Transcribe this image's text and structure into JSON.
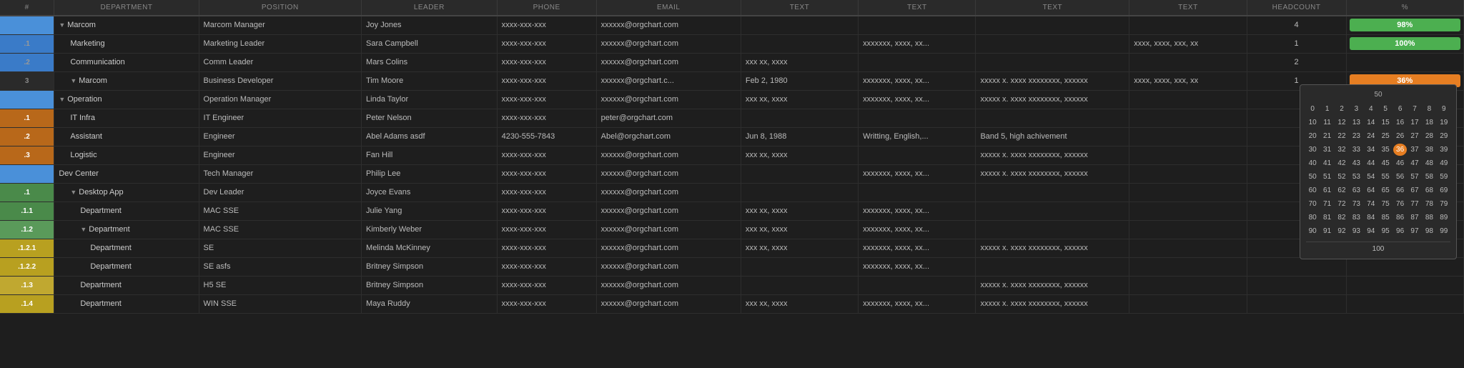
{
  "header": {
    "cols": [
      "#",
      "DEPARTMENT",
      "POSITION",
      "LEADER",
      "PHONE",
      "EMAIL",
      "TEXT",
      "TEXT",
      "TEXT",
      "TEXT",
      "HEADCOUNT",
      "%"
    ]
  },
  "rows": [
    {
      "id": "marcom-header",
      "hash": "",
      "hashClass": "hash-blue",
      "dept": "Marcom",
      "deptIndent": 0,
      "hasTriangle": true,
      "position": "Marcom Manager",
      "leader": "Joy Jones",
      "phone": "xxxx-xxx-xxx",
      "email": "xxxxxx@orgchart.com",
      "text1": "",
      "text2": "",
      "text3": "",
      "text4": "",
      "headcount": "4",
      "percent": "98%",
      "percentClass": "bar-green",
      "showPercent": true
    },
    {
      "id": "marketing",
      "hash": ".1",
      "hashClass": "hash-blue1",
      "dept": "Marketing",
      "deptIndent": 1,
      "hasTriangle": false,
      "position": "Marketing Leader",
      "leader": "Sara Campbell",
      "phone": "xxxx-xxx-xxx",
      "email": "xxxxxx@orgchart.com",
      "text1": "",
      "text2": "xxxxxxx, xxxx, xx...",
      "text3": "",
      "text4": "xxxx, xxxx, xxx, xx",
      "headcount": "1",
      "percent": "100%",
      "percentClass": "bar-green",
      "showPercent": true
    },
    {
      "id": "communication",
      "hash": ".2",
      "hashClass": "hash-blue2",
      "dept": "Communication",
      "deptIndent": 1,
      "hasTriangle": false,
      "position": "Comm Leader",
      "leader": "Mars Colins",
      "phone": "xxxx-xxx-xxx",
      "email": "xxxxxx@orgchart.com",
      "text1": "xxx xx, xxxx",
      "text2": "",
      "text3": "",
      "text4": "",
      "headcount": "2",
      "percent": "",
      "percentClass": "",
      "showPercent": false
    },
    {
      "id": "marcom-biz",
      "hash": "3",
      "hashClass": "hash-3",
      "dept": "Marcom",
      "deptIndent": 1,
      "hasTriangle": true,
      "position": "Business Developer",
      "leader": "Tim Moore",
      "phone": "xxxx-xxx-xxx",
      "email": "xxxxxx@orgchart.c...",
      "text1": "Feb 2, 1980",
      "text2": "xxxxxxx, xxxx, xx...",
      "text3": "xxxxx x. xxxx xxxxxxxx, xxxxxx",
      "text4": "xxxx, xxxx, xxx, xx",
      "headcount": "1",
      "percent": "36%",
      "percentClass": "bar-orange",
      "showPercent": true,
      "showPicker": true
    },
    {
      "id": "operation-header",
      "hash": "",
      "hashClass": "hash-blue",
      "dept": "Operation",
      "deptIndent": 0,
      "hasTriangle": true,
      "position": "Operation Manager",
      "leader": "Linda Taylor",
      "phone": "xxxx-xxx-xxx",
      "email": "xxxxxx@orgchart.com",
      "text1": "xxx xx, xxxx",
      "text2": "xxxxxxx, xxxx, xx...",
      "text3": "xxxxx x. xxxx xxxxxxxx, xxxxxx",
      "text4": "",
      "headcount": "",
      "percent": "",
      "percentClass": "",
      "showPercent": false
    },
    {
      "id": "it-infra",
      "hash": ".1",
      "hashClass": "hash-orange1",
      "dept": "IT Infra",
      "deptIndent": 1,
      "hasTriangle": false,
      "position": "IT Engineer",
      "leader": "Peter Nelson",
      "phone": "xxxx-xxx-xxx",
      "email": "peter@orgchart.com",
      "text1": "",
      "text2": "",
      "text3": "",
      "text4": "",
      "headcount": "",
      "percent": "",
      "percentClass": "",
      "showPercent": false
    },
    {
      "id": "assistant",
      "hash": ".2",
      "hashClass": "hash-orange2",
      "dept": "Assistant",
      "deptIndent": 1,
      "hasTriangle": false,
      "position": "Engineer",
      "leader": "Abel Adams asdf",
      "phone": "4230-555-7843",
      "email": "Abel@orgchart.com",
      "text1": "Jun 8, 1988",
      "text2": "Writting, English,...",
      "text3": "Band 5, high achivement",
      "text4": "",
      "headcount": "",
      "percent": "",
      "percentClass": "",
      "showPercent": false
    },
    {
      "id": "logistic",
      "hash": ".3",
      "hashClass": "hash-orange3",
      "dept": "Logistic",
      "deptIndent": 1,
      "hasTriangle": false,
      "position": "Engineer",
      "leader": "Fan Hill",
      "phone": "xxxx-xxx-xxx",
      "email": "xxxxxx@orgchart.com",
      "text1": "xxx xx, xxxx",
      "text2": "",
      "text3": "xxxxx x. xxxx xxxxxxxx, xxxxxx",
      "text4": "",
      "headcount": "",
      "percent": "",
      "percentClass": "",
      "showPercent": false
    },
    {
      "id": "dev-center",
      "hash": "",
      "hashClass": "hash-blue",
      "dept": "Dev Center",
      "deptIndent": 0,
      "hasTriangle": false,
      "position": "Tech Manager",
      "leader": "Philip Lee",
      "phone": "xxxx-xxx-xxx",
      "email": "xxxxxx@orgchart.com",
      "text1": "",
      "text2": "xxxxxxx, xxxx, xx...",
      "text3": "xxxxx x. xxxx xxxxxxxx, xxxxxx",
      "text4": "",
      "headcount": "",
      "percent": "",
      "percentClass": "",
      "showPercent": false
    },
    {
      "id": "desktop-app",
      "hash": ".1",
      "hashClass": "hash-green1",
      "dept": "Desktop App",
      "deptIndent": 1,
      "hasTriangle": true,
      "position": "Dev Leader",
      "leader": "Joyce Evans",
      "phone": "xxxx-xxx-xxx",
      "email": "xxxxxx@orgchart.com",
      "text1": "",
      "text2": "",
      "text3": "",
      "text4": "",
      "headcount": "",
      "percent": "",
      "percentClass": "",
      "showPercent": false
    },
    {
      "id": "dept-1-1",
      "hash": ".1.1",
      "hashClass": "hash-green2",
      "dept": "Department",
      "deptIndent": 2,
      "hasTriangle": false,
      "position": "MAC SSE",
      "leader": "Julie Yang",
      "phone": "xxxx-xxx-xxx",
      "email": "xxxxxx@orgchart.com",
      "text1": "xxx xx, xxxx",
      "text2": "xxxxxxx, xxxx, xx...",
      "text3": "",
      "text4": "",
      "headcount": "",
      "percent": "",
      "percentClass": "",
      "showPercent": false
    },
    {
      "id": "dept-1-2",
      "hash": ".1.2",
      "hashClass": "hash-green3",
      "dept": "Department",
      "deptIndent": 2,
      "hasTriangle": true,
      "position": "MAC SSE",
      "leader": "Kimberly Weber",
      "phone": "xxxx-xxx-xxx",
      "email": "xxxxxx@orgchart.com",
      "text1": "xxx xx, xxxx",
      "text2": "xxxxxxx, xxxx, xx...",
      "text3": "",
      "text4": "",
      "headcount": "",
      "percent": "",
      "percentClass": "",
      "showPercent": false
    },
    {
      "id": "dept-1-2-1",
      "hash": ".1.2.1",
      "hashClass": "hash-yellow1",
      "dept": "Department",
      "deptIndent": 3,
      "hasTriangle": false,
      "position": "SE",
      "leader": "Melinda McKinney",
      "phone": "xxxx-xxx-xxx",
      "email": "xxxxxx@orgchart.com",
      "text1": "xxx xx, xxxx",
      "text2": "xxxxxxx, xxxx, xx...",
      "text3": "xxxxx x. xxxx xxxxxxxx, xxxxxx",
      "text4": "",
      "headcount": "",
      "percent": "",
      "percentClass": "",
      "showPercent": false
    },
    {
      "id": "dept-1-2-2",
      "hash": ".1.2.2",
      "hashClass": "hash-yellow2",
      "dept": "Department",
      "deptIndent": 3,
      "hasTriangle": false,
      "position": "SE asfs",
      "leader": "Britney Simpson",
      "phone": "xxxx-xxx-xxx",
      "email": "xxxxxx@orgchart.com",
      "text1": "",
      "text2": "xxxxxxx, xxxx, xx...",
      "text3": "",
      "text4": "",
      "headcount": "",
      "percent": "",
      "percentClass": "",
      "showPercent": false
    },
    {
      "id": "dept-1-3",
      "hash": ".1.3",
      "hashClass": "hash-yellow3",
      "dept": "Department",
      "deptIndent": 2,
      "hasTriangle": false,
      "position": "H5 SE",
      "leader": "Britney Simpson",
      "phone": "xxxx-xxx-xxx",
      "email": "xxxxxx@orgchart.com",
      "text1": "",
      "text2": "",
      "text3": "xxxxx x. xxxx xxxxxxxx, xxxxxx",
      "text4": "",
      "headcount": "",
      "percent": "",
      "percentClass": "",
      "showPercent": false
    },
    {
      "id": "dept-1-4",
      "hash": ".1.4",
      "hashClass": "hash-yellow4",
      "dept": "Department",
      "deptIndent": 2,
      "hasTriangle": false,
      "position": "WIN SSE",
      "leader": "Maya Ruddy",
      "phone": "xxxx-xxx-xxx",
      "email": "xxxxxx@orgchart.com",
      "text1": "xxx xx, xxxx",
      "text2": "xxxxxxx, xxxx, xx...",
      "text3": "xxxxx x. xxxx xxxxxxxx, xxxxxx",
      "text4": "",
      "headcount": "",
      "percent": "",
      "percentClass": "",
      "showPercent": false
    }
  ],
  "picker": {
    "header": "50",
    "numbers": [
      0,
      1,
      2,
      3,
      4,
      5,
      6,
      7,
      8,
      9,
      10,
      11,
      12,
      13,
      14,
      15,
      16,
      17,
      18,
      19,
      20,
      21,
      22,
      23,
      24,
      25,
      26,
      27,
      28,
      29,
      30,
      31,
      32,
      33,
      34,
      35,
      36,
      37,
      38,
      39,
      40,
      41,
      42,
      43,
      44,
      45,
      46,
      47,
      48,
      49,
      50,
      51,
      52,
      53,
      54,
      55,
      56,
      57,
      58,
      59,
      60,
      61,
      62,
      63,
      64,
      65,
      66,
      67,
      68,
      69,
      70,
      71,
      72,
      73,
      74,
      75,
      76,
      77,
      78,
      79,
      80,
      81,
      82,
      83,
      84,
      85,
      86,
      87,
      88,
      89,
      90,
      91,
      92,
      93,
      94,
      95,
      96,
      97,
      98,
      99
    ],
    "highlighted": 36,
    "footer": "100"
  }
}
